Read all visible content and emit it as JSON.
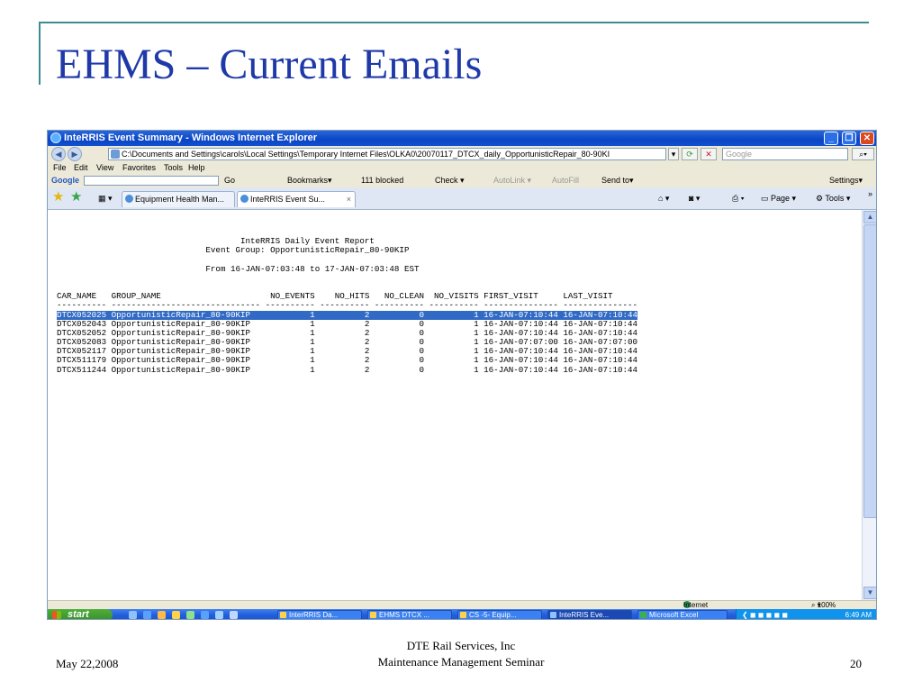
{
  "slide": {
    "title": "EHMS – Current Emails",
    "footer_date": "May 22,2008",
    "footer_line1": "DTE Rail Services, Inc",
    "footer_line2": "Maintenance Management Seminar",
    "page_number": "20",
    "accent_color": "#3c8d93",
    "title_color": "#1f3aa8"
  },
  "window": {
    "title": "InteRRIS Event Summary - Windows Internet Explorer",
    "address": "C:\\Documents and Settings\\carols\\Local Settings\\Temporary Internet Files\\OLKA0\\20070117_DTCX_daily_OpportunisticRepair_80-90KI",
    "search_placeholder": "Google"
  },
  "menu": [
    "File",
    "Edit",
    "View",
    "Favorites",
    "Tools",
    "Help"
  ],
  "google_toolbar": {
    "logo": "Google",
    "go_label": "Go",
    "bookmarks": "Bookmarks▾",
    "blocked": "111 blocked",
    "check": "Check ▾",
    "autolink": "AutoLink ▾",
    "autofill": "AutoFill",
    "send_to": "Send to▾",
    "settings": "Settings▾"
  },
  "tabs": [
    {
      "label": "Equipment Health Man..."
    },
    {
      "label": "InteRRIS Event Su..."
    }
  ],
  "tab_tools": {
    "page": "Page ▾",
    "tools": "Tools ▾"
  },
  "report": {
    "heading1": "InteRRIS Daily Event Report",
    "heading2": "Event Group: OpportunisticRepair_80-90KIP",
    "range": "From 16-JAN-07:03:48 to 17-JAN-07:03:48 EST",
    "columns": [
      "CAR_NAME",
      "GROUP_NAME",
      "NO_EVENTS",
      "NO_HITS",
      "NO_CLEAN",
      "NO_VISITS",
      "FIRST_VISIT",
      "LAST_VISIT"
    ],
    "rows": [
      {
        "car": "DTCX052025",
        "group": "OpportunisticRepair_80-90KIP",
        "events": "1",
        "hits": "2",
        "clean": "0",
        "visits": "1",
        "first": "16-JAN-07:10:44",
        "last": "16-JAN-07:10:44",
        "selected": true
      },
      {
        "car": "DTCX052043",
        "group": "OpportunisticRepair_80-90KIP",
        "events": "1",
        "hits": "2",
        "clean": "0",
        "visits": "1",
        "first": "16-JAN-07:10:44",
        "last": "16-JAN-07:10:44",
        "selected": false
      },
      {
        "car": "DTCX052052",
        "group": "OpportunisticRepair_80-90KIP",
        "events": "1",
        "hits": "2",
        "clean": "0",
        "visits": "1",
        "first": "16-JAN-07:10:44",
        "last": "16-JAN-07:10:44",
        "selected": false
      },
      {
        "car": "DTCX052083",
        "group": "OpportunisticRepair_80-90KIP",
        "events": "1",
        "hits": "2",
        "clean": "0",
        "visits": "1",
        "first": "16-JAN-07:07:00",
        "last": "16-JAN-07:07:00",
        "selected": false
      },
      {
        "car": "DTCX052117",
        "group": "OpportunisticRepair_80-90KIP",
        "events": "1",
        "hits": "2",
        "clean": "0",
        "visits": "1",
        "first": "16-JAN-07:10:44",
        "last": "16-JAN-07:10:44",
        "selected": false
      },
      {
        "car": "DTCX511179",
        "group": "OpportunisticRepair_80-90KIP",
        "events": "1",
        "hits": "2",
        "clean": "0",
        "visits": "1",
        "first": "16-JAN-07:10:44",
        "last": "16-JAN-07:10:44",
        "selected": false
      },
      {
        "car": "DTCX511244",
        "group": "OpportunisticRepair_80-90KIP",
        "events": "1",
        "hits": "2",
        "clean": "0",
        "visits": "1",
        "first": "16-JAN-07:10:44",
        "last": "16-JAN-07:10:44",
        "selected": false
      }
    ]
  },
  "status": {
    "zone": "Internet",
    "zoom": "100%"
  },
  "taskbar": {
    "start": "start",
    "tasks": [
      {
        "label": "InterRRIS Da..."
      },
      {
        "label": "EHMS DTCX ..."
      },
      {
        "label": "CS -5- Equip..."
      },
      {
        "label": "InteRRIS Eve..."
      },
      {
        "label": "Microsoft Excel"
      }
    ],
    "clock": "6:49 AM"
  }
}
